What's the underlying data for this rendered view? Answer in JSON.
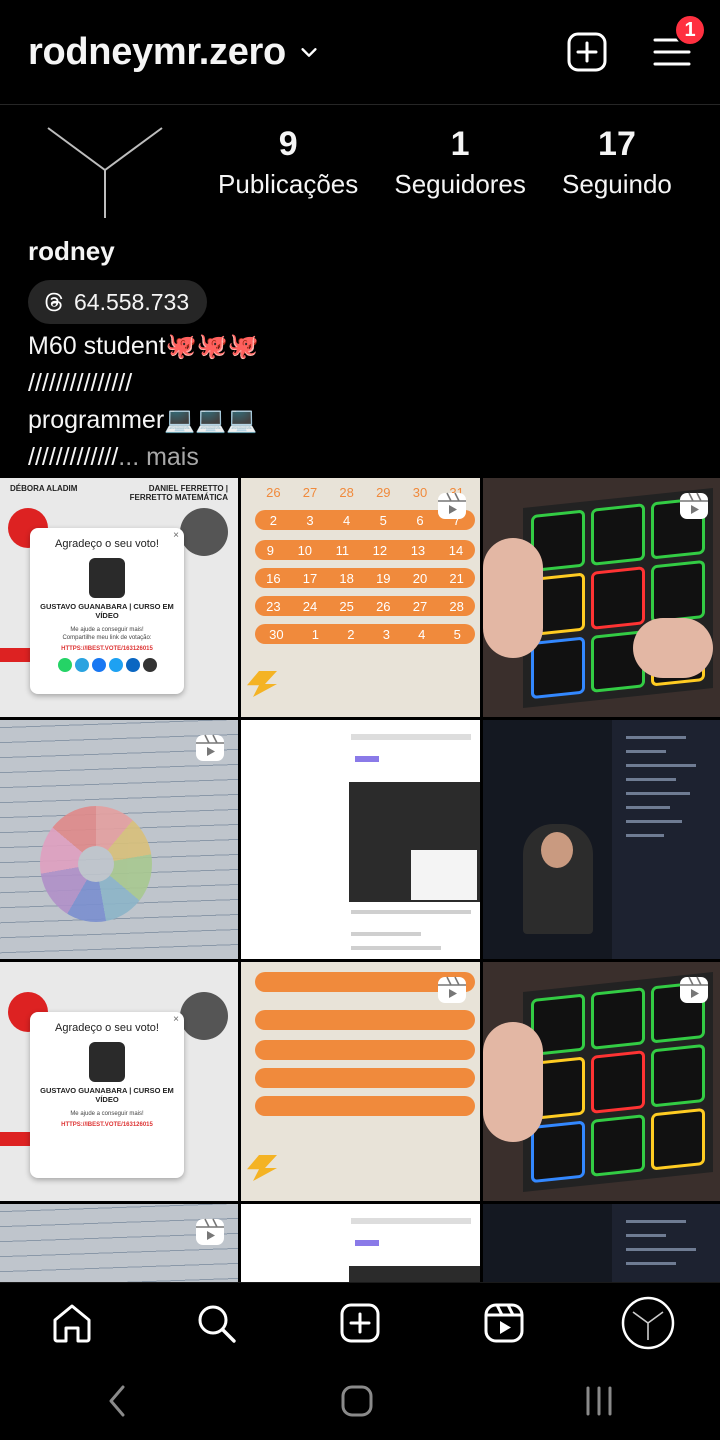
{
  "header": {
    "username": "rodneymr.zero",
    "notification_badge": "1"
  },
  "profile": {
    "stats": [
      {
        "value": "9",
        "label": "Publicações"
      },
      {
        "value": "1",
        "label": "Seguidores"
      },
      {
        "value": "17",
        "label": "Seguindo"
      }
    ],
    "name": "rodney",
    "threads_handle": "64.558.733",
    "bio_lines": [
      "M60 student🐙🐙🐙",
      "///////////////",
      "programmer💻💻💻",
      "/////////////"
    ],
    "bio_more": "... mais"
  },
  "grid": {
    "vote_tile": {
      "header_left": "DÉBORA ALADIM",
      "header_right": "DANIEL FERRETTO | FERRETTO MATEMÁTICA",
      "card_title": "Agradeço o seu voto!",
      "card_name": "GUSTAVO GUANABARA | CURSO EM VÍDEO",
      "card_sub1": "Me ajude a conseguir mais!",
      "card_sub2": "Compartilhe meu link de votação:",
      "card_link": "HTTPS://IBEST.VOTE/163126015"
    },
    "calendar_rows": [
      [
        "26",
        "27",
        "28",
        "29",
        "30",
        "31"
      ],
      [
        "2",
        "3",
        "4",
        "5",
        "6",
        "7"
      ],
      [
        "9",
        "10",
        "11",
        "12",
        "13",
        "14"
      ],
      [
        "16",
        "17",
        "18",
        "19",
        "20",
        "21"
      ],
      [
        "23",
        "24",
        "25",
        "26",
        "27",
        "28"
      ],
      [
        "30",
        "1",
        "2",
        "3",
        "4",
        "5"
      ]
    ]
  },
  "colors": {
    "background": "#000000",
    "badge": "#ff3040",
    "pill": "#262626",
    "muted": "#a8a8a8"
  },
  "icons": [
    "chevron-down-icon",
    "new-post-icon",
    "menu-icon",
    "threads-icon",
    "reel-icon",
    "home-icon",
    "search-icon",
    "create-icon",
    "reels-icon",
    "profile-avatar-icon",
    "android-back-icon",
    "android-home-icon",
    "android-recents-icon"
  ]
}
